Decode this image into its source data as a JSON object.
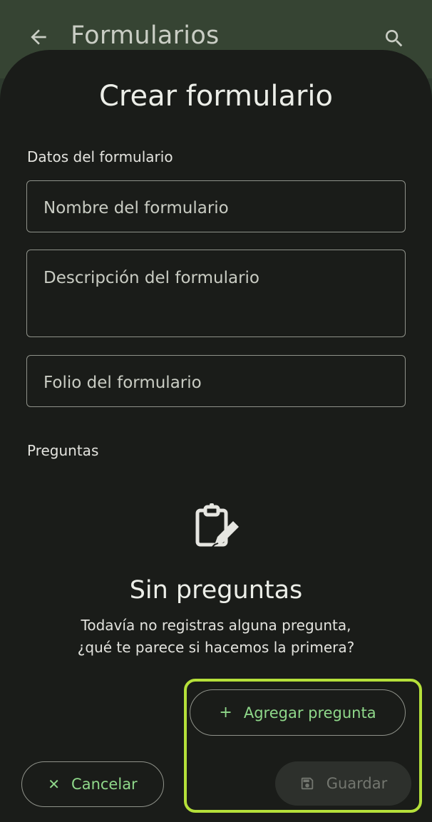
{
  "appbar": {
    "title": "Formularios",
    "back_icon": "arrow-back-icon",
    "search_icon": "search-icon"
  },
  "sheet": {
    "title": "Crear formulario",
    "form_section_label": "Datos del formulario",
    "fields": {
      "name_placeholder": "Nombre del formulario",
      "description_placeholder": "Descripción del formulario",
      "folio_placeholder": "Folio del formulario"
    },
    "questions_section_label": "Preguntas",
    "empty_state": {
      "icon": "clipboard-edit-icon",
      "title": "Sin preguntas",
      "line1": "Todavía no registras alguna pregunta,",
      "line2": "¿qué te parece si hacemos la primera?"
    }
  },
  "actions": {
    "add_question_label": "Agregar pregunta",
    "add_icon": "+",
    "cancel_label": "Cancelar",
    "cancel_icon": "✕",
    "save_label": "Guardar",
    "save_icon": "save-icon",
    "save_enabled": false
  },
  "colors": {
    "accent": "#8fd88a",
    "highlight": "#b5e03a",
    "surface": "#1a1c19",
    "appbar": "#364433"
  }
}
